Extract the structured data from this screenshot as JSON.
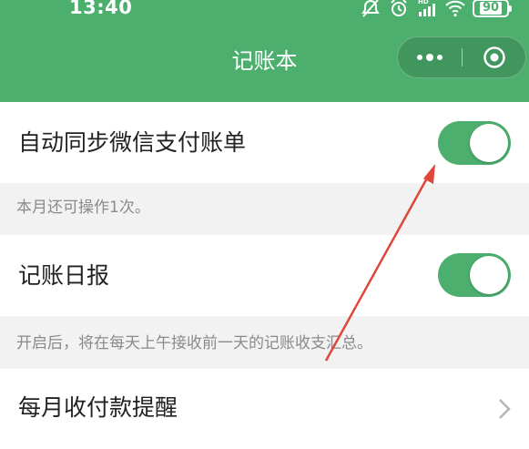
{
  "status_bar": {
    "time": "13:40",
    "battery_level": "90",
    "icons": [
      "alarm-icon",
      "network-hd-icon",
      "wifi-icon",
      "battery-icon"
    ]
  },
  "nav": {
    "title": "记账本",
    "more_icon": "more-dots-icon",
    "close_icon": "close-capsule-icon"
  },
  "settings": {
    "sync_wechat": {
      "label": "自动同步微信支付账单",
      "enabled": true,
      "hint": "本月还可操作1次。"
    },
    "daily_report": {
      "label": "记账日报",
      "enabled": true,
      "hint": "开启后，将在每天上午接收前一天的记账收支汇总。"
    },
    "monthly_reminder": {
      "label": "每月收付款提醒"
    }
  },
  "colors": {
    "brand_green": "#4caf6e",
    "annotation_red": "#e0463a"
  }
}
